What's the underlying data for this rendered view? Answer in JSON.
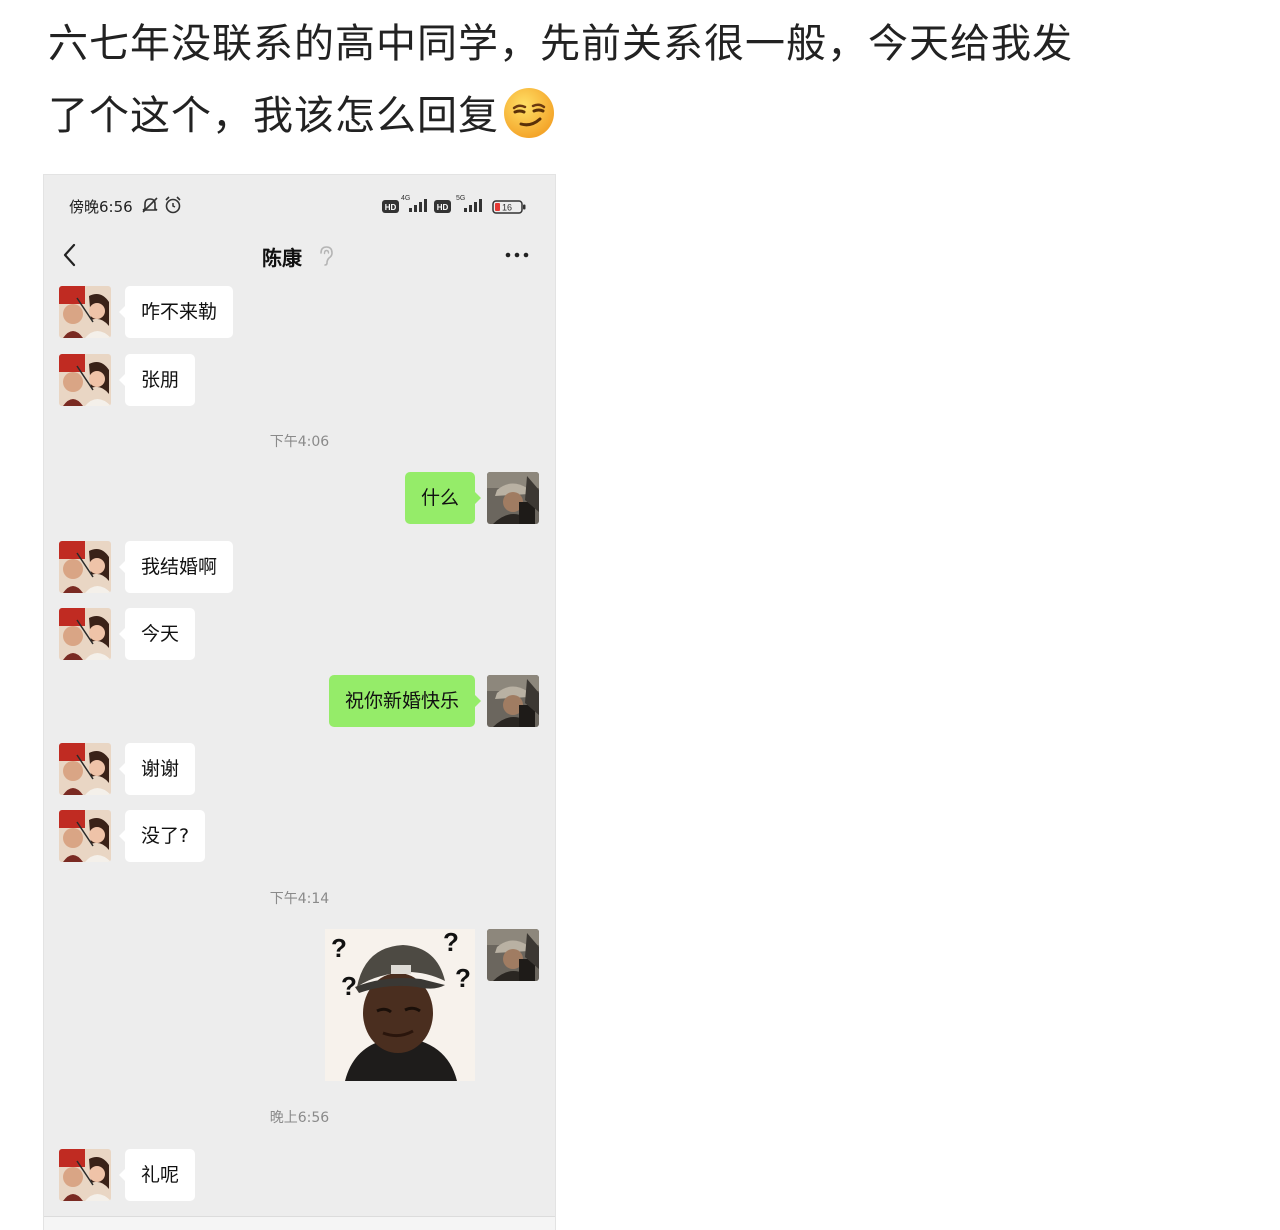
{
  "post": {
    "title_line1": "六七年没联系的高中同学，先前关系很一般，今天给我发",
    "title_line2": "了个这个，我该怎么回复",
    "emoji": "smirk-emoji"
  },
  "status_bar": {
    "time": "傍晚6:56",
    "icons": [
      "bell-muted-icon",
      "alarm-icon",
      "hd-icon",
      "signal-4g-icon",
      "hd-icon",
      "signal-5g-icon",
      "battery-icon"
    ],
    "signal1_label": "4G",
    "signal2_label": "5G",
    "battery_level": "16"
  },
  "nav": {
    "back_icon": "chevron-left-icon",
    "title": "陈康",
    "mute_icon": "ear-icon",
    "more_icon": "more-dots-icon"
  },
  "messages": [
    {
      "from": "contact",
      "type": "text",
      "text": "咋不来勒"
    },
    {
      "from": "contact",
      "type": "text",
      "text": "张朋"
    },
    {
      "type": "time",
      "text": "下午4:06"
    },
    {
      "from": "me",
      "type": "text",
      "text": "什么"
    },
    {
      "from": "contact",
      "type": "text",
      "text": "我结婚啊"
    },
    {
      "from": "contact",
      "type": "text",
      "text": "今天"
    },
    {
      "from": "me",
      "type": "text",
      "text": "祝你新婚快乐"
    },
    {
      "from": "contact",
      "type": "text",
      "text": "谢谢"
    },
    {
      "from": "contact",
      "type": "text",
      "text": "没了?"
    },
    {
      "type": "time",
      "text": "下午4:14"
    },
    {
      "from": "me",
      "type": "sticker",
      "text": "confused-man-question-marks"
    },
    {
      "type": "time",
      "text": "晚上6:56"
    },
    {
      "from": "contact",
      "type": "text",
      "text": "礼呢"
    }
  ],
  "colors": {
    "chat_background": "#ededed",
    "incoming_bubble": "#ffffff",
    "outgoing_bubble": "#95ec69",
    "timestamp_text": "#8a8a8a"
  }
}
